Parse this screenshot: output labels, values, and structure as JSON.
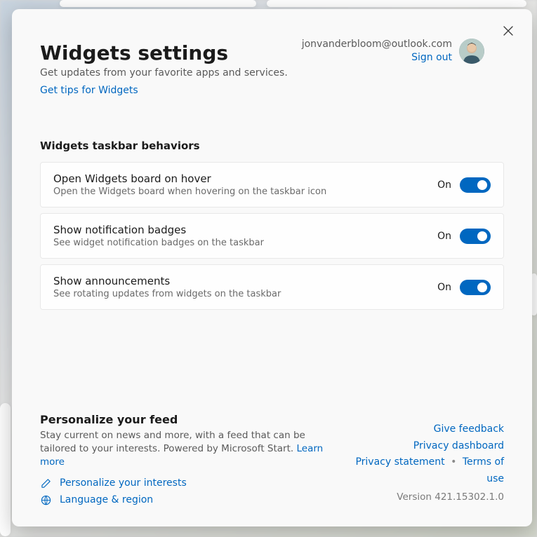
{
  "header": {
    "title": "Widgets settings",
    "subtitle": "Get updates from your favorite apps and services.",
    "tips_link": "Get tips for Widgets"
  },
  "account": {
    "email": "jonvanderbloom@outlook.com",
    "signout": "Sign out"
  },
  "section_behaviors": {
    "heading": "Widgets taskbar behaviors",
    "items": [
      {
        "title": "Open Widgets board on hover",
        "desc": "Open the Widgets board when hovering on the taskbar icon",
        "state": "On"
      },
      {
        "title": "Show notification badges",
        "desc": "See widget notification badges on the taskbar",
        "state": "On"
      },
      {
        "title": "Show announcements",
        "desc": "See rotating updates from widgets on the taskbar",
        "state": "On"
      }
    ]
  },
  "feed": {
    "heading": "Personalize your feed",
    "desc_prefix": "Stay current on news and more, with a feed that can be tailored to your interests. Powered by Microsoft Start. ",
    "learn_more": "Learn more",
    "personalize": "Personalize your interests",
    "language": "Language & region"
  },
  "footer": {
    "feedback": "Give feedback",
    "privacy_dashboard": "Privacy dashboard",
    "privacy_statement": "Privacy statement",
    "terms": "Terms of use",
    "version": "Version 421.15302.1.0"
  }
}
